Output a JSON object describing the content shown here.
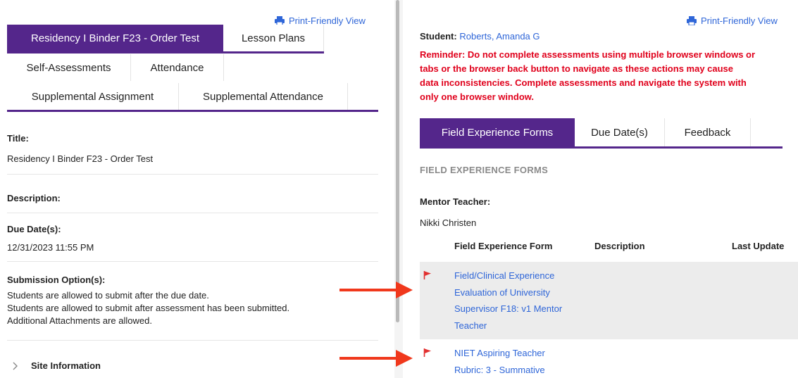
{
  "left": {
    "print_label": "Print-Friendly View",
    "tabs_row1": [
      "Residency I Binder F23 - Order Test",
      "Lesson Plans"
    ],
    "tabs_row2": [
      "Self-Assessments",
      "Attendance"
    ],
    "tabs_row3": [
      "Supplemental Assignment",
      "Supplemental Attendance"
    ],
    "title_label": "Title:",
    "title_value": "Residency I Binder F23 - Order Test",
    "description_label": "Description:",
    "due_label": "Due Date(s):",
    "due_value": "12/31/2023 11:55 PM",
    "submission_label": "Submission Option(s):",
    "submission_lines": [
      "Students are allowed to submit after the due date.",
      "Students are allowed to submit after assessment has been submitted.",
      "Additional Attachments are allowed."
    ],
    "site_info_label": "Site Information"
  },
  "right": {
    "print_label": "Print-Friendly View",
    "student_label": "Student:",
    "student_name": "Roberts, Amanda G",
    "reminder_lines": [
      "Reminder: Do not complete assessments using multiple browser windows or",
      "tabs or the browser back button to navigate as these actions may cause",
      "data inconsistencies. Complete assessments and navigate the system with",
      "only one browser window."
    ],
    "tabs": [
      "Field Experience Forms",
      "Due Date(s)",
      "Feedback"
    ],
    "section_heading": "FIELD EXPERIENCE FORMS",
    "mentor_label": "Mentor Teacher:",
    "mentor_name": "Nikki Christen",
    "table_headers": [
      "Field Experience Form",
      "Description",
      "Last Update"
    ],
    "rows": [
      {
        "lines": [
          "Field/Clinical Experience",
          "Evaluation of University",
          "Supervisor F18: v1 Mentor",
          "Teacher"
        ]
      },
      {
        "lines": [
          "NIET Aspiring Teacher",
          "Rubric: 3 - Summative"
        ]
      }
    ]
  },
  "colors": {
    "accent_purple": "#54268b",
    "link_blue": "#2f66d8",
    "reminder_red": "#e0001b",
    "annotation_arrow": "#f0381c",
    "highlight_row": "#ececec"
  }
}
